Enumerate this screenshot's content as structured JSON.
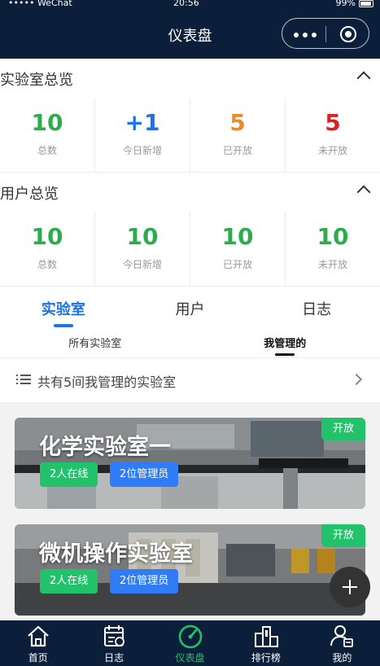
{
  "status_bar": {
    "carrier": "••••• WeChat",
    "time": "20:56",
    "battery": "99%"
  },
  "navbar": {
    "title": "仪表盘"
  },
  "lab_overview": {
    "title": "实验室总览",
    "stats": [
      {
        "value": "10",
        "label": "总数",
        "color": "#2eab4c"
      },
      {
        "value": "+1",
        "label": "今日新增",
        "color": "#1b73e8"
      },
      {
        "value": "5",
        "label": "已开放",
        "color": "#f08a24"
      },
      {
        "value": "5",
        "label": "未开放",
        "color": "#e02020"
      }
    ]
  },
  "user_overview": {
    "title": "用户总览",
    "stats": [
      {
        "value": "10",
        "label": "总数",
        "color": "#2eab4c"
      },
      {
        "value": "10",
        "label": "今日新增",
        "color": "#2eab4c"
      },
      {
        "value": "10",
        "label": "已开放",
        "color": "#2eab4c"
      },
      {
        "value": "10",
        "label": "未开放",
        "color": "#2eab4c"
      }
    ]
  },
  "tabs": [
    "实验室",
    "用户",
    "日志"
  ],
  "subtabs": [
    "所有实验室",
    "我管理的"
  ],
  "summary": {
    "text": "共有5间我管理的实验室"
  },
  "labs": [
    {
      "name": "化学实验室一",
      "online": "2人在线",
      "admins": "2位管理员",
      "state": "开放"
    },
    {
      "name": "微机操作实验室",
      "online": "2人在线",
      "admins": "2位管理员",
      "state": "开放"
    }
  ],
  "tabbar": [
    {
      "label": "首页",
      "icon": "home-icon"
    },
    {
      "label": "日志",
      "icon": "calendar-icon"
    },
    {
      "label": "仪表盘",
      "icon": "gauge-icon"
    },
    {
      "label": "排行榜",
      "icon": "podium-icon"
    },
    {
      "label": "我的",
      "icon": "user-icon"
    }
  ],
  "colors": {
    "navy": "#0b1f3a",
    "green": "#22c26a",
    "blue": "#2f7cf6"
  }
}
